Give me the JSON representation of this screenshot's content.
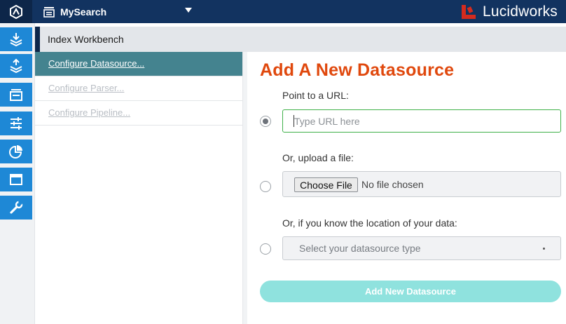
{
  "topbar": {
    "logo_icon": "fusion-logo-icon",
    "app_icon": "database-stack-icon",
    "app_name": "MySearch",
    "brand_icon": "lucidworks-mark-icon",
    "brand_name": "Lucidworks",
    "colors": {
      "bar": "#123360",
      "brand_mark": "#d52b1e"
    }
  },
  "rail": {
    "items": [
      {
        "icon": "index-workbench-icon"
      },
      {
        "icon": "query-workbench-icon"
      },
      {
        "icon": "collections-icon"
      },
      {
        "icon": "pipelines-icon"
      },
      {
        "icon": "analytics-icon"
      },
      {
        "icon": "app-studio-icon"
      },
      {
        "icon": "system-tools-icon"
      }
    ],
    "color": "#1e88d6"
  },
  "header": {
    "title": "Index Workbench"
  },
  "steps": [
    {
      "label": "Configure Datasource...",
      "active": true
    },
    {
      "label": "Configure Parser...",
      "active": false
    },
    {
      "label": "Configure Pipeline...",
      "active": false
    }
  ],
  "form": {
    "title": "Add A New Datasource",
    "url_label": "Point to a URL:",
    "url_placeholder": "Type URL here",
    "upload_label": "Or, upload a file:",
    "choose_file": "Choose File",
    "no_file": "No file chosen",
    "location_label": "Or, if you know the location of your data:",
    "select_placeholder": "Select your datasource type",
    "submit": "Add New Datasource",
    "selected_option": "url",
    "colors": {
      "title": "#e0480d",
      "submit": "#8fe2de",
      "input_focus": "#40b14a"
    }
  }
}
